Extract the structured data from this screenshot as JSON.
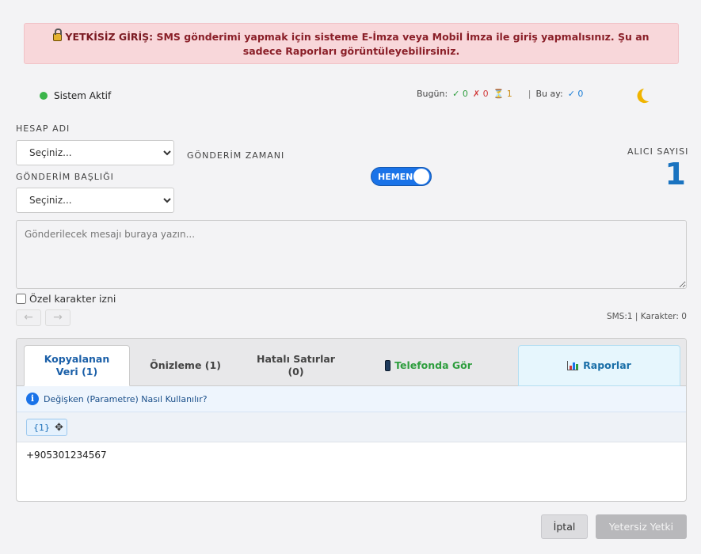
{
  "alert": {
    "title": "YETKİSİZ GİRİŞ:",
    "message": "SMS gönderimi yapmak için sisteme E-İmza veya Mobil İmza ile giriş yapmalısınız. Şu an sadece Raporları görüntüleyebilirsiniz."
  },
  "status": {
    "label": "Sistem Aktif",
    "color": "#3bb54a"
  },
  "stats": {
    "today_label": "Bugün:",
    "today_ok": "✓ 0",
    "today_fail": "✗ 0",
    "today_wait": "⏳ 1",
    "separator": "|",
    "month_label": "Bu ay:",
    "month_ok": "✓ 0"
  },
  "form": {
    "account_label": "HESAP ADI",
    "account_value": "Seçiniz...",
    "title_label": "GÖNDERİM BAŞLIĞI",
    "title_value": "Seçiniz...",
    "time_label": "GÖNDERİM ZAMANI",
    "toggle_label": "HEMEN",
    "recipient_label": "ALICI SAYISI",
    "recipient_count": "1",
    "message_placeholder": "Gönderilecek mesajı buraya yazın...",
    "special_chars_label": "Özel karakter izni",
    "undo": "←",
    "redo": "→",
    "sms_info": "SMS:1 | Karakter: 0"
  },
  "tabs": [
    {
      "label": "Kopyalanan Veri (1)"
    },
    {
      "label": "Önizleme (1)"
    },
    {
      "label": "Hatalı Satırlar (0)"
    },
    {
      "label": "Telefonda Gör"
    },
    {
      "label": "Raporlar"
    }
  ],
  "help": {
    "text": "Değişken (Parametre) Nasıl Kullanılır?"
  },
  "param_chip": "{1}",
  "rows": [
    "+905301234567"
  ],
  "buttons": {
    "cancel": "İptal",
    "submit": "Yetersiz Yetki"
  }
}
